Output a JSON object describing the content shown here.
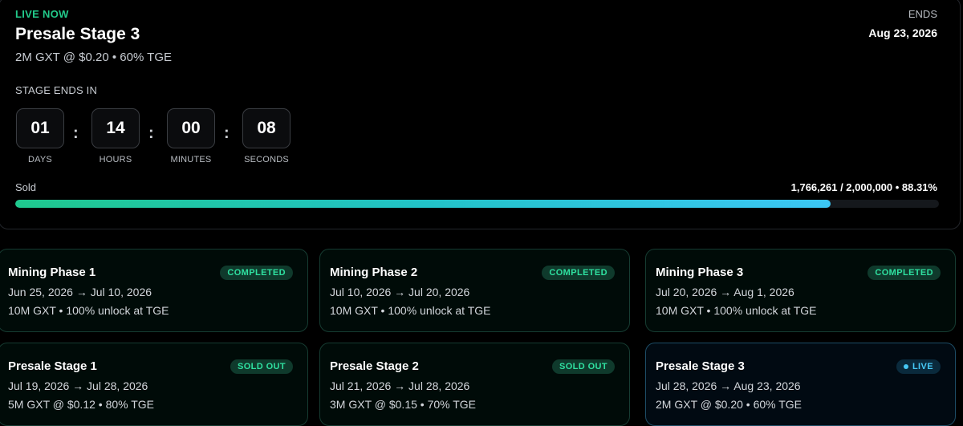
{
  "hero": {
    "live_label": "LIVE NOW",
    "title": "Presale Stage 3",
    "subtitle": "2M GXT @ $0.20 • 60% TGE",
    "ends_label": "ENDS",
    "ends_date": "Aug 23, 2026",
    "stage_ends_label": "STAGE ENDS IN",
    "countdown": {
      "days": "01",
      "days_label": "DAYS",
      "hours": "14",
      "hours_label": "HOURS",
      "minutes": "00",
      "minutes_label": "MINUTES",
      "seconds": "08",
      "seconds_label": "SECONDS",
      "separator": ":"
    },
    "sold_label": "Sold",
    "sold_stats": "1,766,261 / 2,000,000 • 88.31%",
    "sold_fraction": 0.8831,
    "colors": {
      "accent_green": "#22c98a",
      "accent_cyan": "#3cc7f5"
    }
  },
  "stages": [
    {
      "name": "Mining Phase 1",
      "dates": "Jun 25, 2026 → Jul 10, 2026",
      "detail": "10M GXT • 100% unlock at TGE",
      "status": "COMPLETED"
    },
    {
      "name": "Mining Phase 2",
      "dates": "Jul 10, 2026 → Jul 20, 2026",
      "detail": "10M GXT • 100% unlock at TGE",
      "status": "COMPLETED"
    },
    {
      "name": "Mining Phase 3",
      "dates": "Jul 20, 2026 → Aug 1, 2026",
      "detail": "10M GXT • 100% unlock at TGE",
      "status": "COMPLETED"
    },
    {
      "name": "Presale Stage 1",
      "dates": "Jul 19, 2026 → Jul 28, 2026",
      "detail": "5M GXT @ $0.12 • 80% TGE",
      "status": "SOLD OUT"
    },
    {
      "name": "Presale Stage 2",
      "dates": "Jul 21, 2026 → Jul 28, 2026",
      "detail": "3M GXT @ $0.15 • 70% TGE",
      "status": "SOLD OUT"
    },
    {
      "name": "Presale Stage 3",
      "dates": "Jul 28, 2026 → Aug 23, 2026",
      "detail": "2M GXT @ $0.20 • 60% TGE",
      "status": "LIVE"
    }
  ]
}
